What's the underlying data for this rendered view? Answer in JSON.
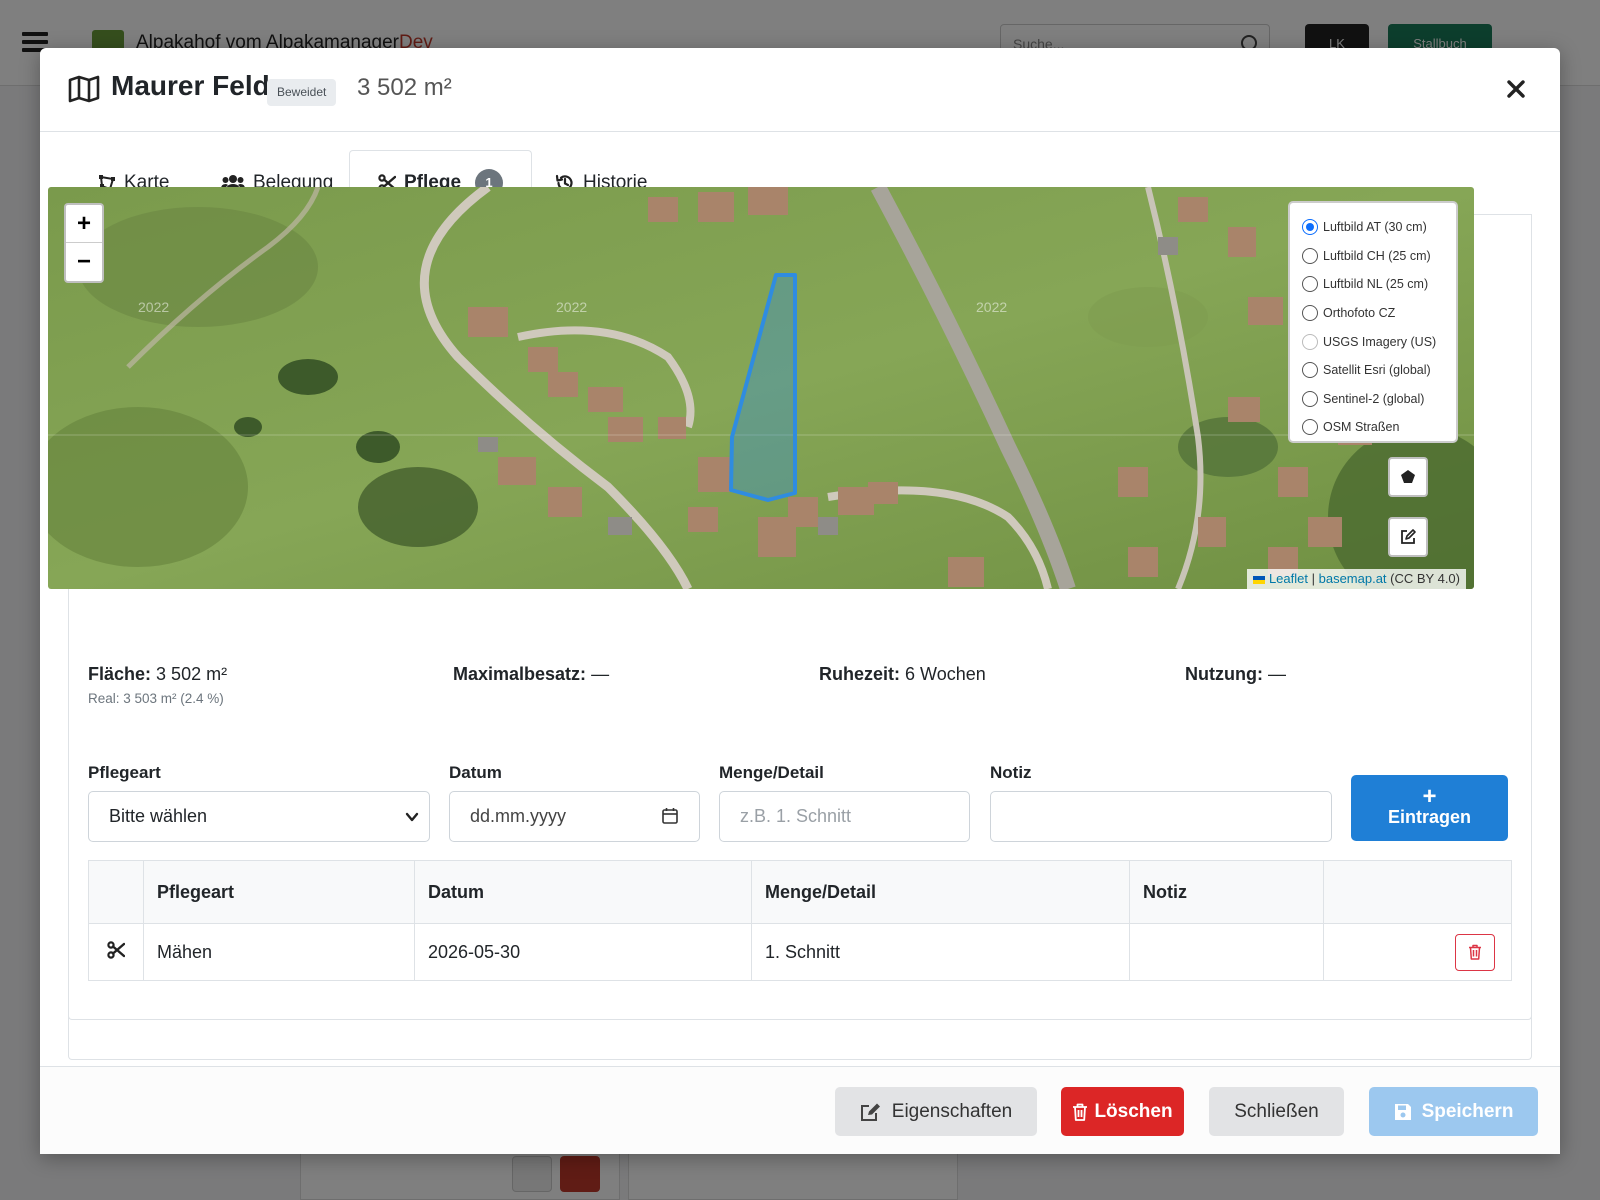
{
  "background": {
    "app_title": "Alpakahof vom Alpakamanager",
    "app_title_suffix": "Dev",
    "search_placeholder": "Suche...",
    "btn1": "LK",
    "btn2": "Stallbuch"
  },
  "modal": {
    "title": "Maurer Feld",
    "badge": "Beweidet",
    "area": "3 502 m²",
    "tabs": [
      {
        "label": "Karte"
      },
      {
        "label": "Belegung"
      },
      {
        "label": "Pflege",
        "count": "1"
      },
      {
        "label": "Historie"
      }
    ]
  },
  "map": {
    "zoom_in": "+",
    "zoom_out": "−",
    "imagery_year": "2022",
    "layers": [
      {
        "label": "Luftbild AT (30 cm)",
        "selected": true
      },
      {
        "label": "Luftbild CH (25 cm)"
      },
      {
        "label": "Luftbild NL (25 cm)"
      },
      {
        "label": "Orthofoto CZ"
      },
      {
        "label": "USGS Imagery (US)",
        "disabled": true
      },
      {
        "label": "Satellit Esri (global)"
      },
      {
        "label": "Sentinel-2 (global)"
      },
      {
        "label": "OSM Straßen"
      }
    ],
    "attribution": {
      "leaflet": "Leaflet",
      "separator": " | ",
      "source": "basemap.at",
      "license": " (CC BY 4.0)"
    },
    "colors": {
      "polygon": "#2f8ce0"
    }
  },
  "stats": {
    "flaeche_label": "Fläche:",
    "flaeche_value": "3 502 m²",
    "flaeche_real": "Real: 3 503 m² (2.4 %)",
    "maximalbesatz_label": "Maximalbesatz:",
    "maximalbesatz_value": "—",
    "ruhezeit_label": "Ruhezeit:",
    "ruhezeit_value": "6 Wochen",
    "nutzung_label": "Nutzung:",
    "nutzung_value": "—"
  },
  "form": {
    "pflegeart_label": "Pflegeart",
    "pflegeart_value": "Bitte wählen",
    "datum_label": "Datum",
    "datum_placeholder": "dd.mm.yyyy",
    "menge_label": "Menge/Detail",
    "menge_placeholder": "z.B. 1. Schnitt",
    "notiz_label": "Notiz",
    "notiz_value": "",
    "add_button": "Eintragen"
  },
  "table": {
    "headers": [
      "Pflegeart",
      "Datum",
      "Menge/Detail",
      "Notiz"
    ],
    "rows": [
      {
        "pflegeart": "Mähen",
        "datum": "2026-05-30",
        "menge": "1. Schnitt",
        "notiz": ""
      }
    ]
  },
  "footer": {
    "eigenschaften": "Eigenschaften",
    "loeschen": "Löschen",
    "schliessen": "Schließen",
    "speichern": "Speichern"
  },
  "colors": {
    "primary": "#1f7fd6",
    "danger": "#dc3545",
    "secondary": "#e2e3e5",
    "save_disabled": "#9cc8ef"
  }
}
